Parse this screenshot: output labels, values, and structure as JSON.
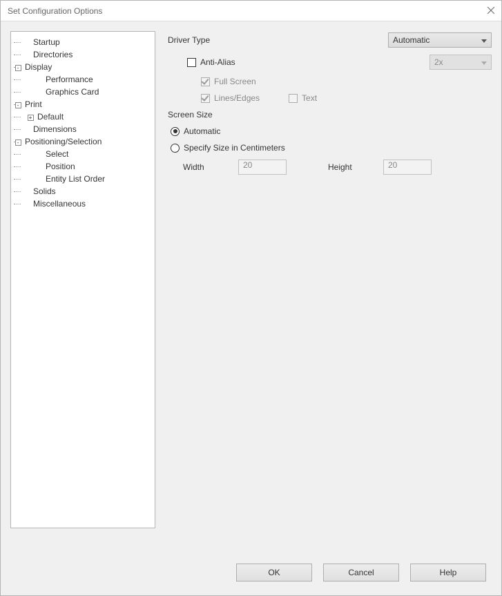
{
  "title": "Set Configuration Options",
  "tree": {
    "startup": "Startup",
    "directories": "Directories",
    "display": "Display",
    "performance": "Performance",
    "graphics_card": "Graphics Card",
    "print": "Print",
    "default": "Default",
    "dimensions": "Dimensions",
    "positioning": "Positioning/Selection",
    "select": "Select",
    "position": "Position",
    "entity_list": "Entity List Order",
    "solids": "Solids",
    "misc": "Miscellaneous"
  },
  "driver": {
    "label": "Driver Type",
    "value": "Automatic",
    "anti_alias": "Anti-Alias",
    "aa_value": "2x",
    "full_screen": "Full Screen",
    "lines_edges": "Lines/Edges",
    "text": "Text"
  },
  "screen": {
    "label": "Screen Size",
    "auto": "Automatic",
    "specify": "Specify Size in Centimeters",
    "width_label": "Width",
    "width_value": "20",
    "height_label": "Height",
    "height_value": "20"
  },
  "buttons": {
    "ok": "OK",
    "cancel": "Cancel",
    "help": "Help"
  }
}
